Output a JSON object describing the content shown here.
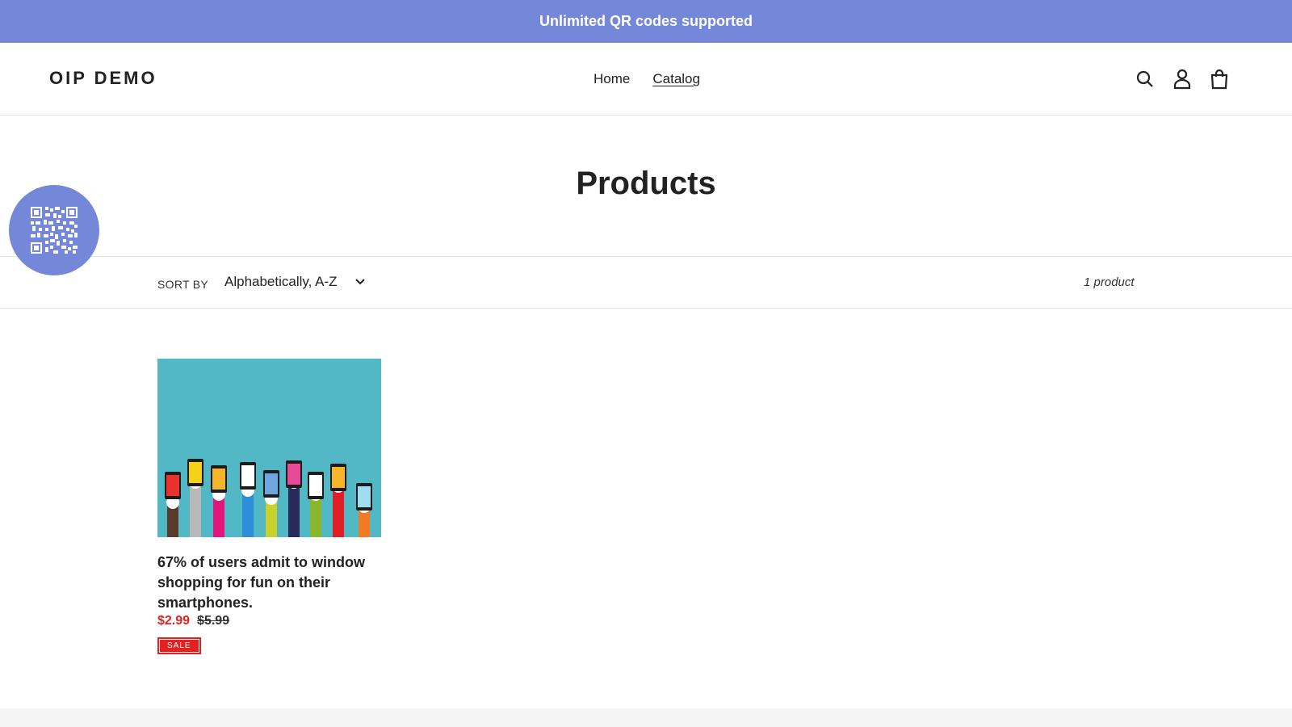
{
  "announcement": {
    "text": "Unlimited QR codes supported"
  },
  "header": {
    "logo": "OIP DEMO",
    "nav": [
      {
        "label": "Home",
        "active": false
      },
      {
        "label": "Catalog",
        "active": true
      }
    ],
    "icons": [
      "search-icon",
      "account-icon",
      "cart-icon"
    ]
  },
  "qr_widget": {
    "icon": "qr-code-icon",
    "color": "#7587d8"
  },
  "page": {
    "title": "Products"
  },
  "filters": {
    "sort_label": "SORT BY",
    "sort_value": "Alphabetically, A-Z",
    "product_count": "1 product"
  },
  "products": [
    {
      "title": "67% of users admit to window shopping for fun on their smartphones.",
      "sale_price": "$2.99",
      "regular_price": "$5.99",
      "badge": "SALE"
    }
  ],
  "colors": {
    "accent": "#7587d8",
    "sale": "#e22120",
    "image_background": "#53b8c6"
  }
}
